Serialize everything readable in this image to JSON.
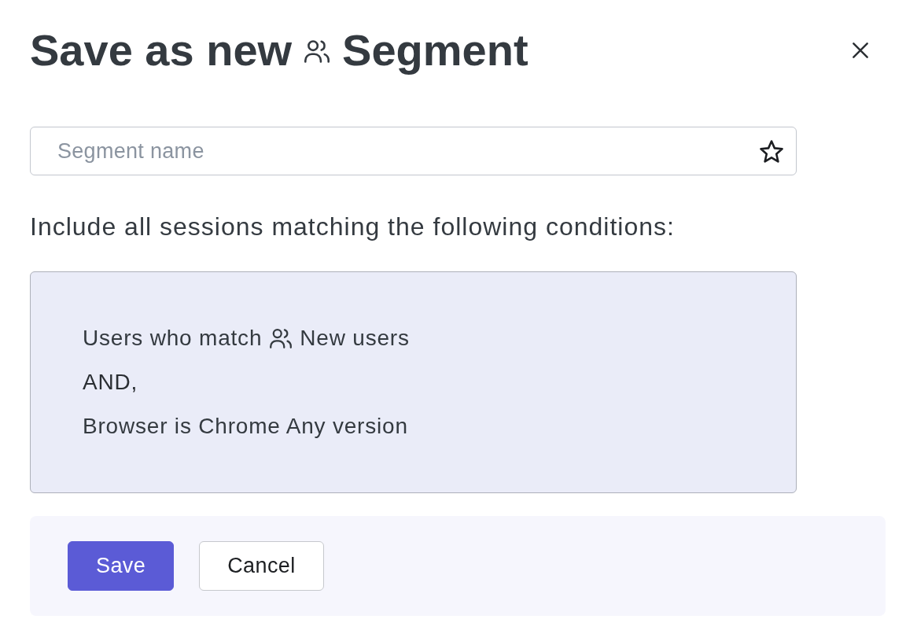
{
  "dialog": {
    "title": {
      "before_icon": "Save as new",
      "after_icon": "Segment"
    }
  },
  "segment_name": {
    "placeholder": "Segment name",
    "favorite": false
  },
  "conditions_label": "Include all sessions matching the following conditions:",
  "conditions": [
    {
      "kind": "segment_match",
      "text": "Users who match",
      "segment": "New users"
    },
    {
      "kind": "operator",
      "text": "AND,"
    },
    {
      "kind": "filter",
      "text": "Browser is Chrome Any version"
    }
  ],
  "buttons": [
    {
      "kind": "primary",
      "label": "Save"
    },
    {
      "kind": "secondary",
      "label": "Cancel"
    }
  ]
}
